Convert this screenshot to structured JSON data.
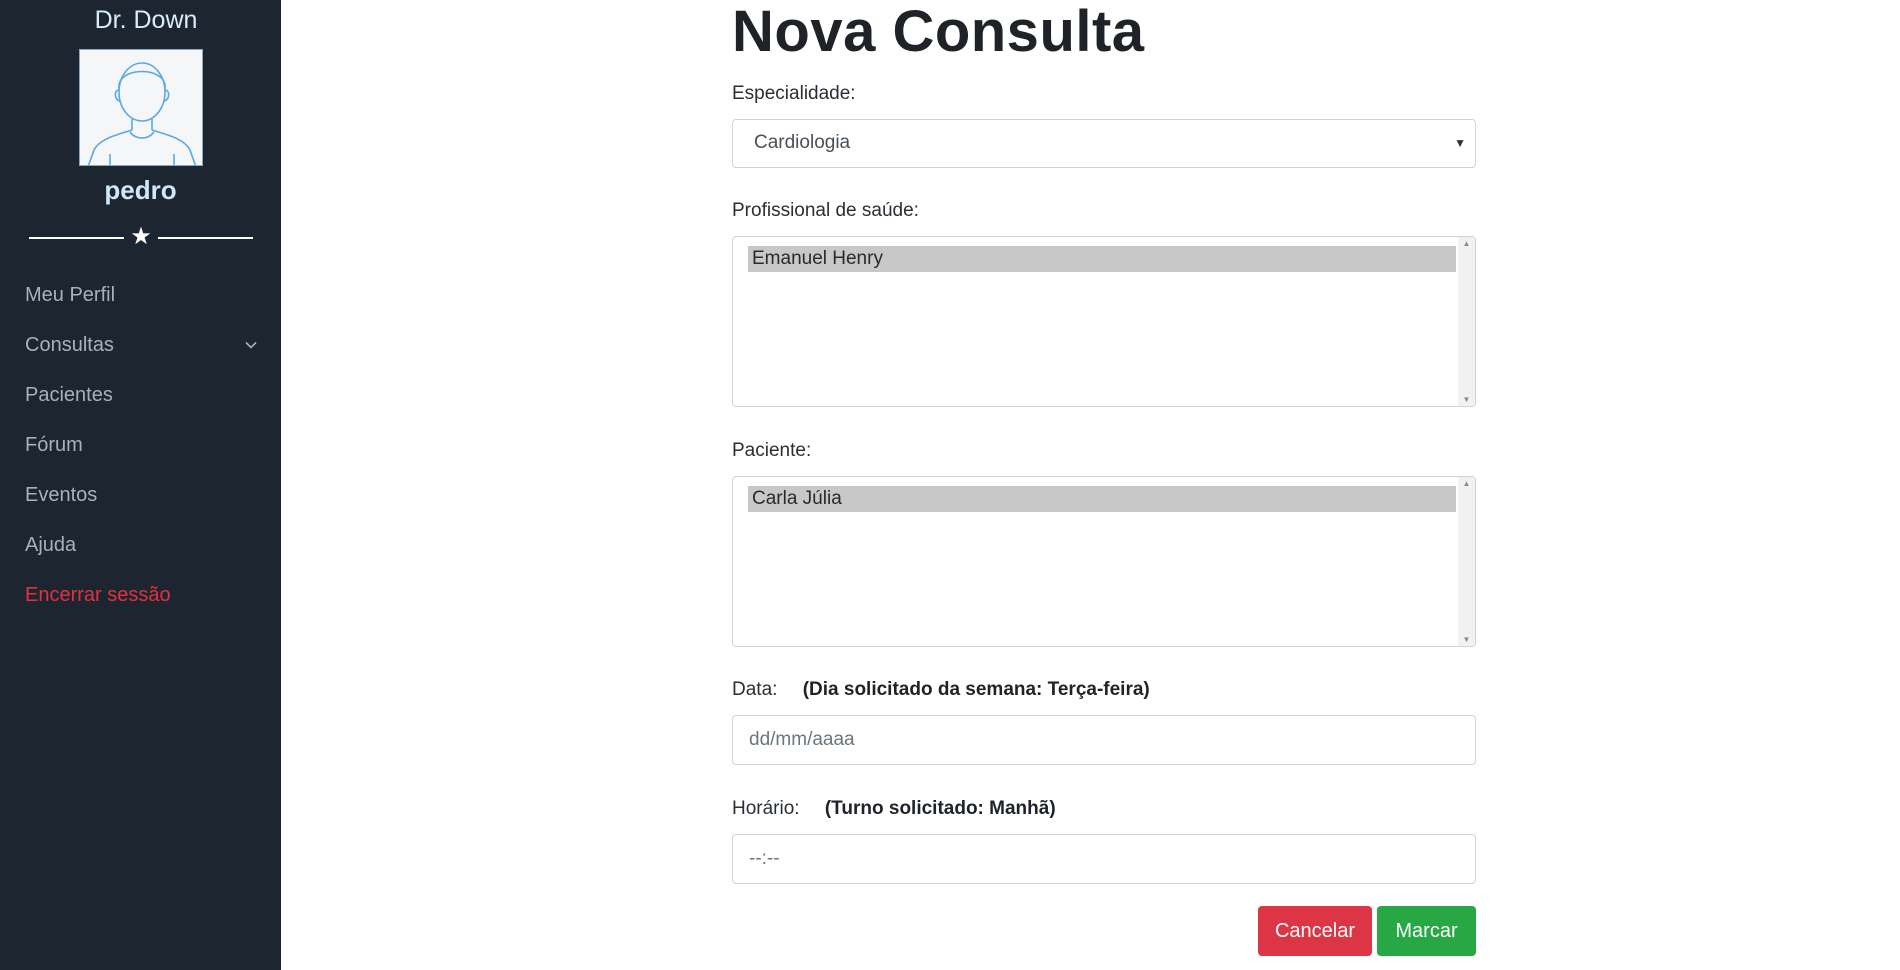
{
  "sidebar": {
    "brand": "Dr. Down",
    "username": "pedro",
    "items": [
      {
        "label": "Meu Perfil"
      },
      {
        "label": "Consultas"
      },
      {
        "label": "Pacientes"
      },
      {
        "label": "Fórum"
      },
      {
        "label": "Eventos"
      },
      {
        "label": "Ajuda"
      },
      {
        "label": "Encerrar sessão"
      }
    ]
  },
  "form": {
    "title": "Nova Consulta",
    "especialidade": {
      "label": "Especialidade:",
      "value": "Cardiologia"
    },
    "profissional": {
      "label": "Profissional de saúde:",
      "selected": "Emanuel Henry"
    },
    "paciente": {
      "label": "Paciente:",
      "selected": "Carla Júlia"
    },
    "data": {
      "label": "Data:",
      "hint": "(Dia solicitado da semana: Terça-feira)",
      "placeholder": "dd/mm/aaaa"
    },
    "horario": {
      "label": "Horário:",
      "hint": "(Turno solicitado: Manhã)",
      "placeholder": "--:--"
    },
    "buttons": {
      "cancel": "Cancelar",
      "submit": "Marcar"
    }
  },
  "colors": {
    "sidebar_bg": "#1c2530",
    "logout": "#e0323f",
    "cancel": "#dc3545",
    "submit": "#28a745"
  },
  "icons": {
    "avatar": "user-avatar-icon",
    "divider": "star-icon",
    "consultas": "chevron-down-icon",
    "select": "caret-down-icon"
  }
}
